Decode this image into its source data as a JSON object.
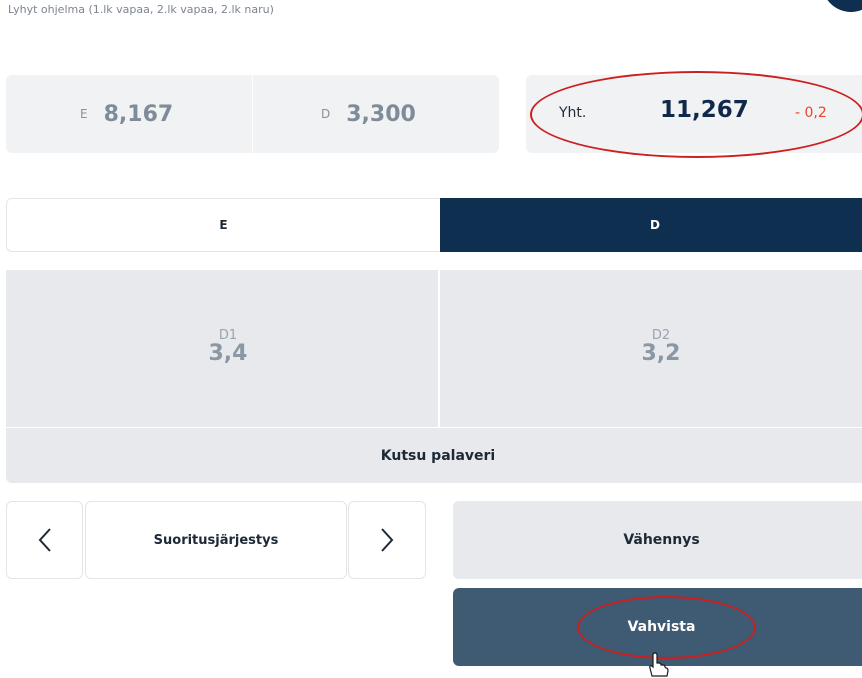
{
  "header": {
    "subtitle": "Lyhyt ohjelma (1.lk vapaa, 2.lk vapaa, 2.lk naru)"
  },
  "scores": {
    "e_label": "E",
    "e_value": "8,167",
    "d_label": "D",
    "d_value": "3,300"
  },
  "total": {
    "label": "Yht.",
    "value": "11,267",
    "penalty": "- 0,2"
  },
  "tabs": [
    {
      "label": "E",
      "active": false
    },
    {
      "label": "D",
      "active": true
    }
  ],
  "d_panel": {
    "d1_label": "D1",
    "d1_value": "3,4",
    "d2_label": "D2",
    "d2_value": "3,2"
  },
  "actions": {
    "call_meeting": "Kutsu palaveri",
    "order": "Suoritusjärjestys",
    "deduction": "Vähennys",
    "confirm": "Vahvista"
  },
  "icons": {
    "prev": "chevron-left-icon",
    "next": "chevron-right-icon",
    "cursor": "hand-pointer-icon"
  },
  "colors": {
    "primary": "#0e2f4f",
    "confirm": "#3f5a73",
    "penalty": "#e8442b",
    "annotation": "#cc1f1f"
  }
}
